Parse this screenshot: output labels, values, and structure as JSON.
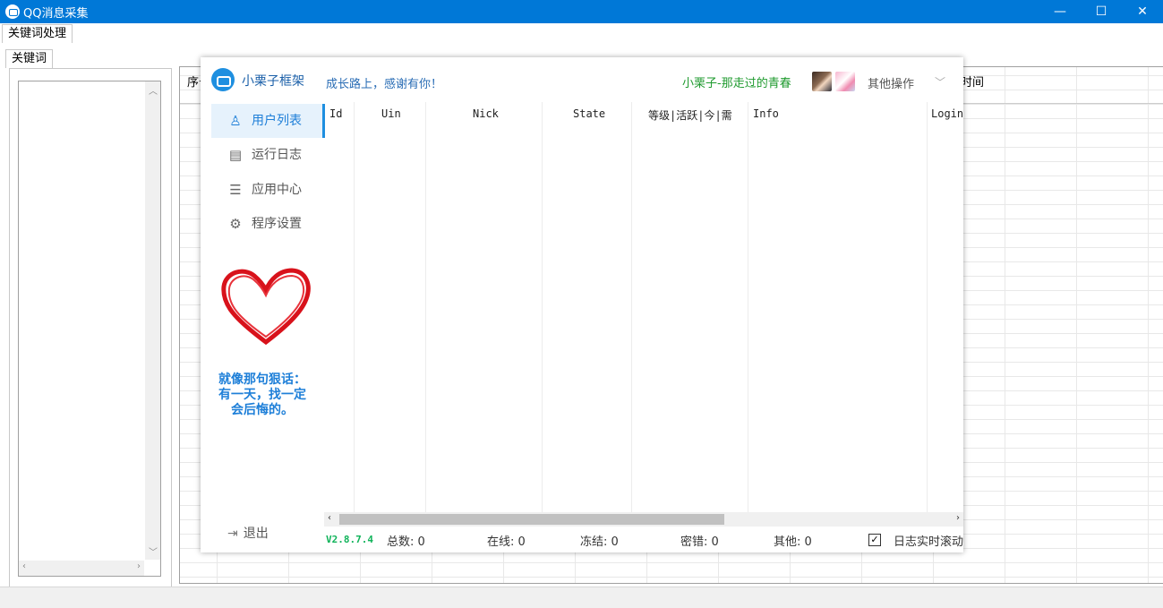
{
  "window": {
    "title": "QQ消息采集",
    "minimize": "—",
    "maximize": "☐",
    "close": "✕"
  },
  "tabs": {
    "main": "关键词处理",
    "keyword": "关键词"
  },
  "background_grid": {
    "headers": [
      "序号",
      "时间"
    ]
  },
  "overlay": {
    "app_name": "小栗子框架",
    "slogan": "成长路上，感谢有你！",
    "user_text": "小栗子-那走过的青春",
    "more_label": "其他操作",
    "chevron": "﹀",
    "nav": [
      {
        "label": "用户列表",
        "icon": "user-icon",
        "glyph": "♙"
      },
      {
        "label": "运行日志",
        "icon": "document-icon",
        "glyph": "▤"
      },
      {
        "label": "应用中心",
        "icon": "list-icon",
        "glyph": "☰"
      },
      {
        "label": "程序设置",
        "icon": "gear-icon",
        "glyph": "⚙"
      }
    ],
    "quote": [
      "就像那句狠话：",
      "有一天，找一定",
      "会后悔的。"
    ],
    "logout_label": "退出",
    "logout_glyph": "⇥",
    "table_columns": [
      "Id",
      "Uin",
      "Nick",
      "State",
      "等级|活跃|今|需",
      "Info",
      "LoginT"
    ],
    "footer": {
      "version": "V2.8.7.4",
      "total": "总数: 0",
      "online": "在线: 0",
      "frozen": "冻结: 0",
      "pwd_error": "密错: 0",
      "other": "其他: 0",
      "log_scroll_label": "日志实时滚动",
      "log_scroll_checked": "✓"
    }
  },
  "colors": {
    "titlebar": "#0078d7",
    "accent": "#1e8fe0",
    "user_green": "#1e9a2e",
    "version_green": "#10b35a"
  }
}
